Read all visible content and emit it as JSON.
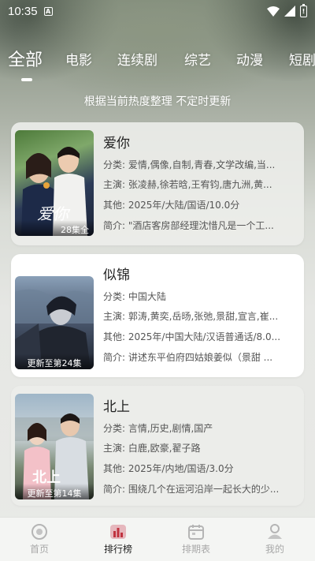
{
  "status_bar": {
    "time": "10:35",
    "sim_icon": "A",
    "battery_label": "!"
  },
  "tabs": [
    {
      "label": "全部",
      "active": true
    },
    {
      "label": "电影"
    },
    {
      "label": "连续剧"
    },
    {
      "label": "综艺"
    },
    {
      "label": "动漫"
    },
    {
      "label": "短剧"
    }
  ],
  "subtitle": "根据当前热度整理 不定时更新",
  "items": [
    {
      "title": "爱你",
      "badge": "28集全",
      "poster_logo": "爱你",
      "category": "分类: 爱情,偶像,自制,青春,文学改编,当...",
      "cast": "主演: 张凌赫,徐若晗,王宥钧,唐九洲,黄...",
      "other": "其他: 2025年/大陆/国语/10.0分",
      "intro": "简介: \"酒店客房部经理沈惜凡是一个工..."
    },
    {
      "title": "似锦",
      "badge": "更新至第24集",
      "category": "分类: 中国大陆",
      "cast": "主演: 郭涛,黄奕,岳旸,张弛,景甜,宣言,崔...",
      "other": "其他: 2025年/中国大陆/汉语普通话/8.0...",
      "intro": "简介: 讲述东平伯府四姑娘姜似（景甜 ..."
    },
    {
      "title": "北上",
      "badge": "更新至第14集",
      "poster_logo": "北上",
      "category": "分类: 言情,历史,剧情,国产",
      "cast": "主演: 白鹿,欧豪,翟子路",
      "other": "其他: 2025年/内地/国语/3.0分",
      "intro": "简介: 围绕几个在运河沿岸一起长大的少..."
    }
  ],
  "bottom_nav": [
    {
      "label": "首页",
      "icon": "home-icon"
    },
    {
      "label": "排行榜",
      "icon": "ranking-icon",
      "active": true
    },
    {
      "label": "排期表",
      "icon": "calendar-icon"
    },
    {
      "label": "我的",
      "icon": "profile-icon"
    }
  ]
}
